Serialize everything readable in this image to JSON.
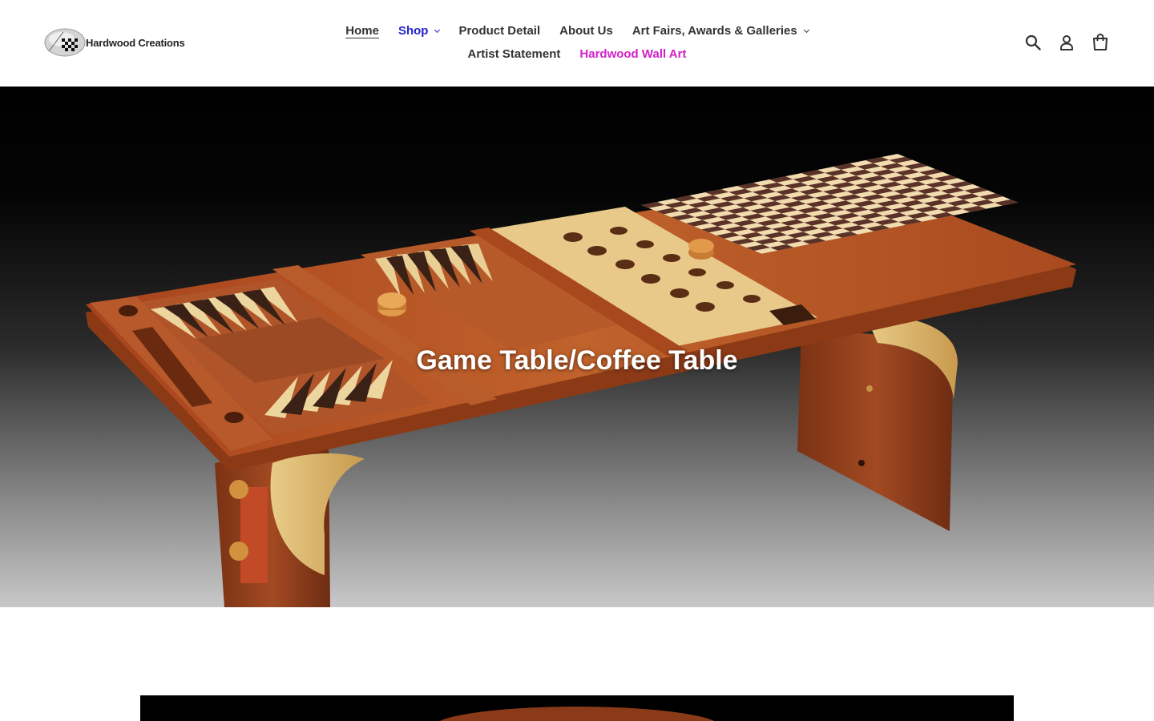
{
  "brand": {
    "name": "Hardwood Creations"
  },
  "nav": {
    "row1": [
      {
        "label": "Home",
        "state": "active"
      },
      {
        "label": "Shop",
        "dropdown": true,
        "color": "#2323c9"
      },
      {
        "label": "Product Detail"
      },
      {
        "label": "About Us"
      },
      {
        "label": "Art Fairs, Awards & Galleries",
        "dropdown": true
      }
    ],
    "row2": [
      {
        "label": "Artist Statement"
      },
      {
        "label": "Hardwood Wall Art",
        "color": "#d21fc8"
      }
    ]
  },
  "header_icons": [
    "search-icon",
    "account-icon",
    "cart-icon"
  ],
  "hero": {
    "title": "Game Table/Coffee Table"
  },
  "colors": {
    "text": "#333333",
    "shop_link": "#2323c9",
    "wall_art_link": "#d21fc8",
    "hero_title": "#ffffff"
  }
}
